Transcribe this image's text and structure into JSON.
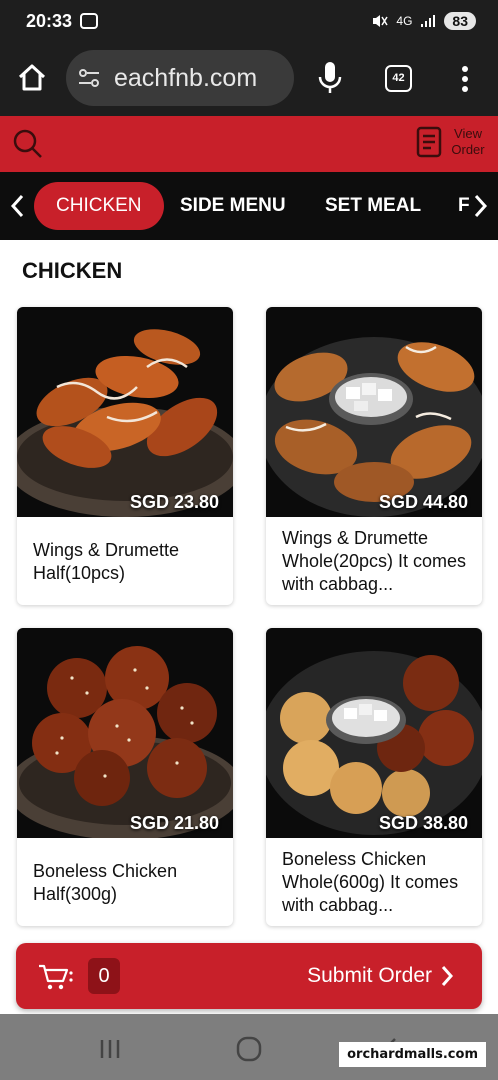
{
  "status_bar": {
    "time": "20:33",
    "network": "4G",
    "battery": "83"
  },
  "browser": {
    "url": "eachfnb.com",
    "tab_count": "42"
  },
  "header": {
    "view_order_label": "View Order"
  },
  "categories": [
    {
      "label": "CHICKEN",
      "active": true
    },
    {
      "label": "SIDE MENU",
      "active": false
    },
    {
      "label": "SET MEAL",
      "active": false
    },
    {
      "label": "F",
      "active": false
    }
  ],
  "section_title": "CHICKEN",
  "products": [
    {
      "name": "Wings & Drumette Half(10pcs)",
      "price": "SGD 23.80"
    },
    {
      "name": "Wings & Drumette Whole(20pcs) It comes with cabbag...",
      "price": "SGD 44.80"
    },
    {
      "name": "Boneless Chicken Half(300g)",
      "price": "SGD 21.80"
    },
    {
      "name": "Boneless Chicken Whole(600g) It comes with cabbag...",
      "price": "SGD 38.80"
    }
  ],
  "cart": {
    "count": "0",
    "submit_label": "Submit Order"
  },
  "watermark": "orchardmalls.com",
  "colors": {
    "brand_red": "#c8202a",
    "nav_black": "#0d0d0d",
    "chrome_dark": "#1e1e1e"
  }
}
